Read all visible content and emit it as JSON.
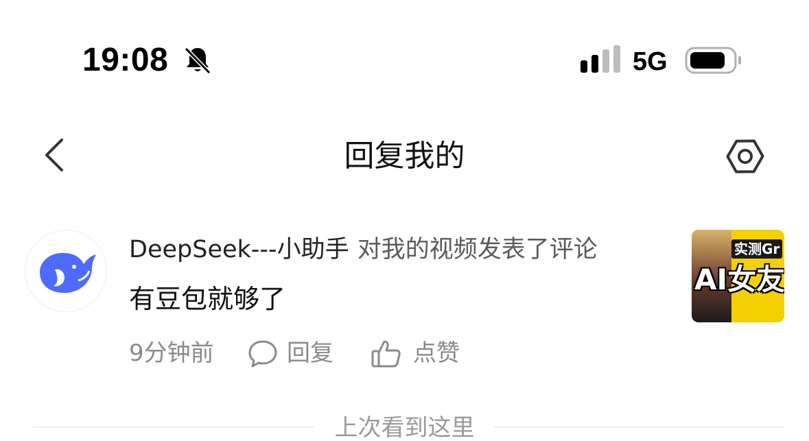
{
  "status_bar": {
    "time": "19:08",
    "network": "5G",
    "icons": [
      "bell-muted-icon",
      "signal-icon",
      "battery-icon"
    ]
  },
  "header": {
    "title": "回复我的",
    "icons": [
      "back-chevron-icon",
      "settings-hexagon-icon"
    ]
  },
  "comment": {
    "username": "DeepSeek---小助手",
    "action": "对我的视频发表了评论",
    "text": "有豆包就够了",
    "time": "9分钟前",
    "reply_label": "回复",
    "like_label": "点赞",
    "avatar_icon": "whale-logo-icon",
    "thumbnail": {
      "banner": "实测Gr",
      "caption": "AI女友"
    }
  },
  "divider": {
    "label": "上次看到这里"
  },
  "colors": {
    "avatar_whale": "#4d6bfe",
    "thumbnail_bg": "#f5d000",
    "muted_text": "#8a8a8a",
    "divider": "#e2e2e2"
  }
}
